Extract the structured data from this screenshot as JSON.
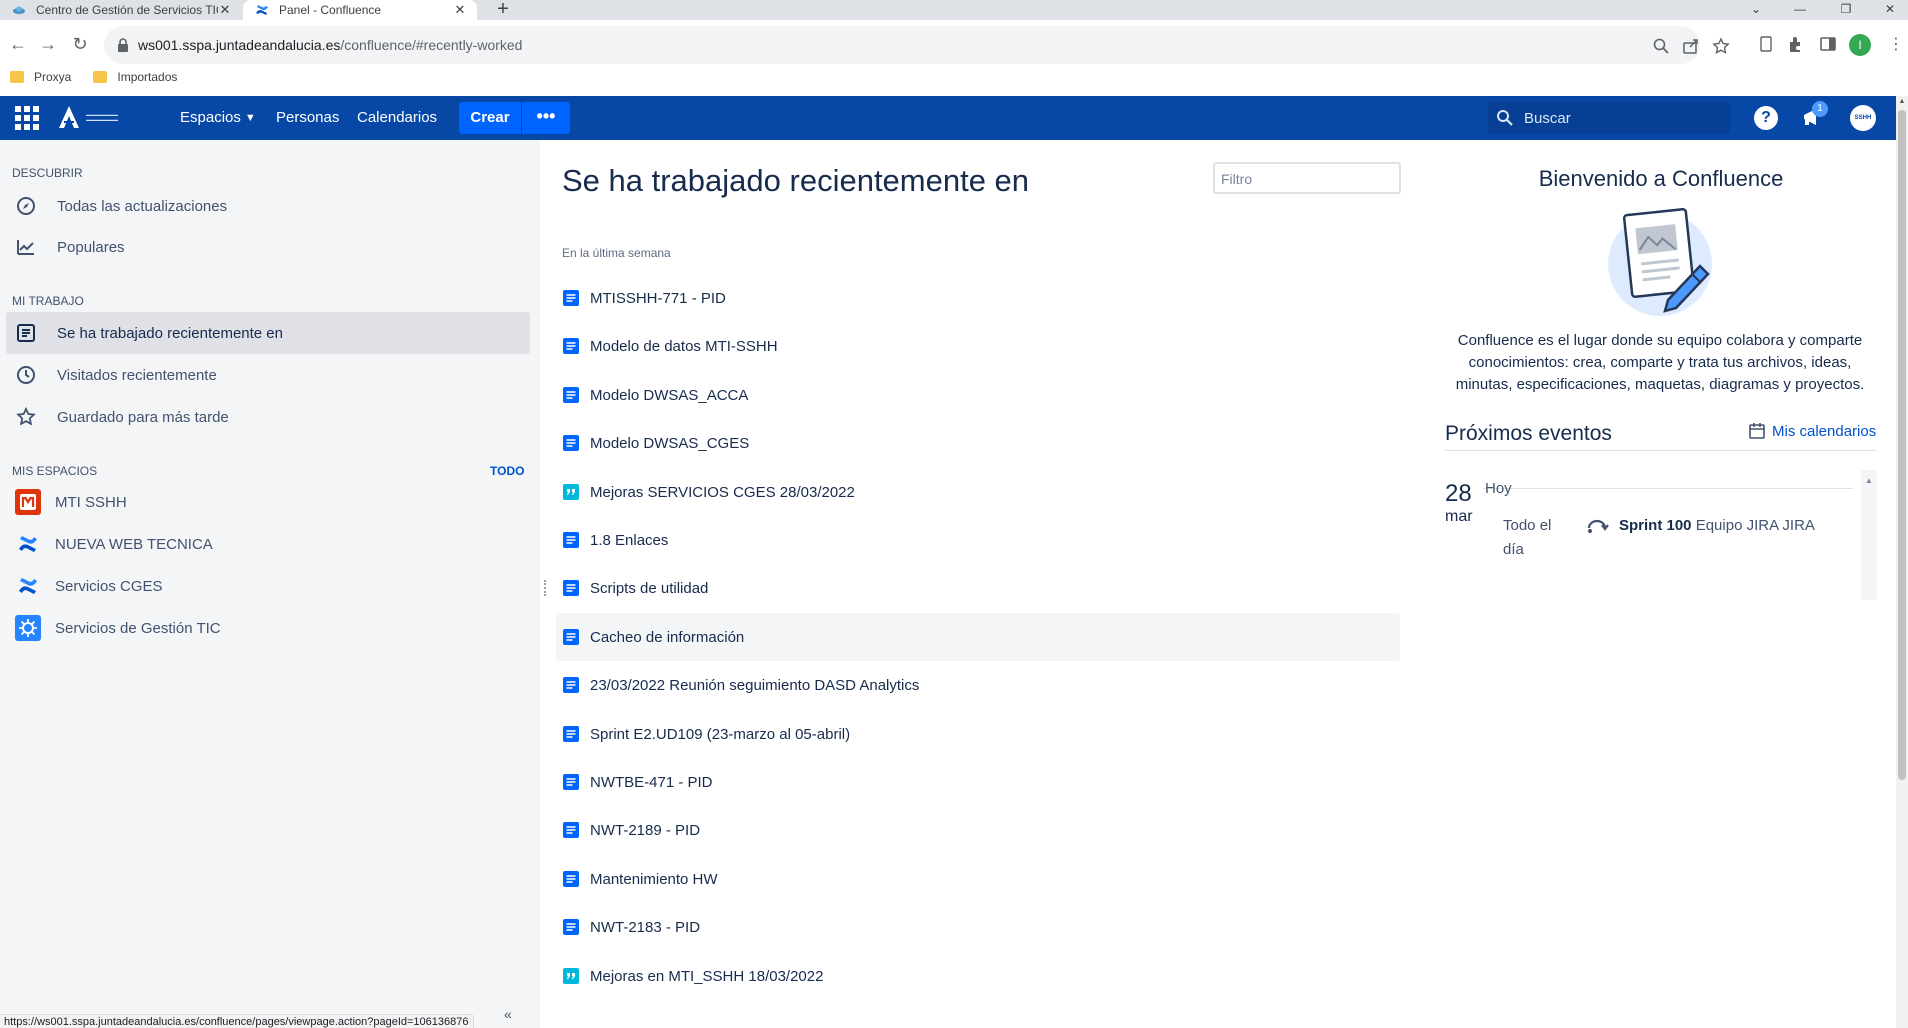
{
  "browser": {
    "tabs": [
      {
        "title": "Centro de Gestión de Servicios TIC"
      },
      {
        "title": "Panel - Confluence"
      }
    ],
    "new_tab": "+",
    "url_host": "ws001.sspa.juntadeandalucia.es",
    "url_path": "/confluence/#recently-worked",
    "bookmarks": [
      {
        "label": "Proxya"
      },
      {
        "label": "Importados"
      }
    ],
    "profile_initial": "I",
    "status_url": "https://ws001.sspa.juntadeandalucia.es/confluence/pages/viewpage.action?pageId=106136876"
  },
  "topnav": {
    "spaces": "Espacios",
    "people": "Personas",
    "calendars": "Calendarios",
    "create": "Crear",
    "more": "•••",
    "search_placeholder": "Buscar",
    "help": "?",
    "notifications_count": "1",
    "avatar_text": "SSHH"
  },
  "sidebar": {
    "discover_heading": "DESCUBRIR",
    "discover_items": [
      {
        "label": "Todas las actualizaciones",
        "icon": "compass-icon"
      },
      {
        "label": "Populares",
        "icon": "trending-icon"
      }
    ],
    "mywork_heading": "MI TRABAJO",
    "mywork_items": [
      {
        "label": "Se ha trabajado recientemente en",
        "icon": "page-icon",
        "active": true
      },
      {
        "label": "Visitados recientemente",
        "icon": "clock-icon"
      },
      {
        "label": "Guardado para más tarde",
        "icon": "star-icon"
      }
    ],
    "spaces_heading": "MIS ESPACIOS",
    "spaces_all": "TODO",
    "spaces": [
      {
        "label": "MTI SSHH",
        "icon": "mti-space-icon",
        "color": "#de350b"
      },
      {
        "label": "NUEVA WEB TECNICA",
        "icon": "confluence-space-icon",
        "color": "#0052cc"
      },
      {
        "label": "Servicios CGES",
        "icon": "confluence-space-icon",
        "color": "#0052cc"
      },
      {
        "label": "Servicios de Gestión TIC",
        "icon": "gear-space-icon",
        "color": "#2684ff"
      }
    ]
  },
  "main": {
    "title": "Se ha trabajado recientemente en",
    "filter_placeholder": "Filtro",
    "section_label": "En la última semana",
    "items": [
      {
        "title": "MTISSHH-771 - PID",
        "type": "page"
      },
      {
        "title": "Modelo de datos MTI-SSHH",
        "type": "page"
      },
      {
        "title": "Modelo DWSAS_ACCA",
        "type": "page"
      },
      {
        "title": "Modelo DWSAS_CGES",
        "type": "page"
      },
      {
        "title": "Mejoras SERVICIOS CGES 28/03/2022",
        "type": "blog"
      },
      {
        "title": "1.8 Enlaces",
        "type": "page"
      },
      {
        "title": "Scripts de utilidad",
        "type": "page"
      },
      {
        "title": "Cacheo de información",
        "type": "page"
      },
      {
        "title": "23/03/2022 Reunión seguimiento DASD Analytics",
        "type": "page"
      },
      {
        "title": "Sprint E2.UD109 (23-marzo al 05-abril)",
        "type": "page"
      },
      {
        "title": "NWTBE-471 - PID",
        "type": "page"
      },
      {
        "title": "NWT-2189 - PID",
        "type": "page"
      },
      {
        "title": "Mantenimiento HW",
        "type": "page"
      },
      {
        "title": "NWT-2183 - PID",
        "type": "page"
      },
      {
        "title": "Mejoras en MTI_SSHH 18/03/2022",
        "type": "blog"
      }
    ]
  },
  "right": {
    "welcome_title": "Bienvenido a Confluence",
    "welcome_text": "Confluence es el lugar donde su equipo colabora y comparte conocimientos: crea, comparte y trata tus archivos, ideas, minutas, especificaciones, maquetas, diagramas y proyectos.",
    "events_title": "Próximos eventos",
    "calendars_link": "Mis calendarios",
    "event": {
      "day": "28",
      "month": "mar",
      "today": "Hoy",
      "all_day": "Todo el día",
      "name": "Sprint 100",
      "calendar": "Equipo JIRA JIRA"
    }
  },
  "colors": {
    "nav_bg": "#0747a6",
    "create_bg": "#0065ff",
    "sidebar_bg": "#f4f5f7",
    "link": "#0052cc",
    "text": "#172b4d"
  }
}
